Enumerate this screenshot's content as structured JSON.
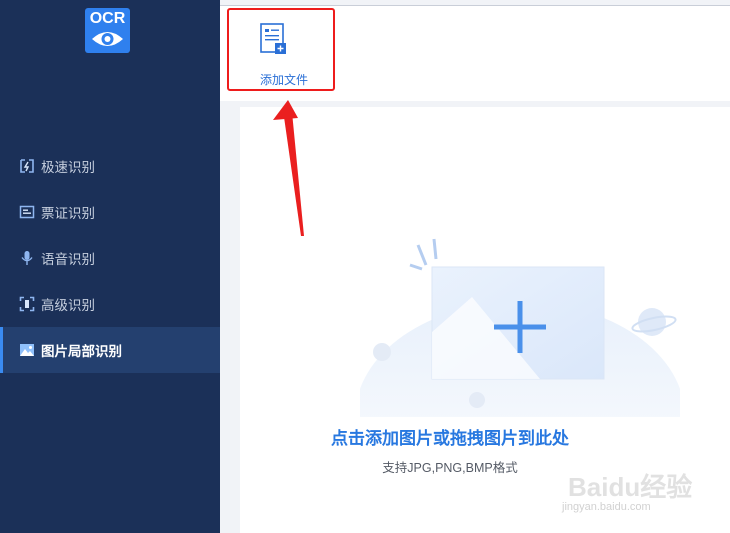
{
  "app": {
    "logo_text": "OCR",
    "accent_color": "#2f80ee"
  },
  "sidebar": {
    "items": [
      {
        "label": "极速识别",
        "icon": "lightning-scan-icon",
        "active": false
      },
      {
        "label": "票证识别",
        "icon": "ticket-icon",
        "active": false
      },
      {
        "label": "语音识别",
        "icon": "microphone-icon",
        "active": false
      },
      {
        "label": "高级识别",
        "icon": "scan-frame-icon",
        "active": false
      },
      {
        "label": "图片局部识别",
        "icon": "image-icon",
        "active": true
      }
    ]
  },
  "toolbar": {
    "add_file_label": "添加文件",
    "add_file_icon": "add-document-icon"
  },
  "drop_zone": {
    "title": "点击添加图片或拖拽图片到此处",
    "subtitle": "支持JPG,PNG,BMP格式",
    "illustration_icon": "add-image-icon"
  },
  "annotation": {
    "highlight_color": "#ee1c1c"
  },
  "watermark": {
    "brand": "Baidu经验",
    "sub": "jingyan.baidu.com"
  }
}
